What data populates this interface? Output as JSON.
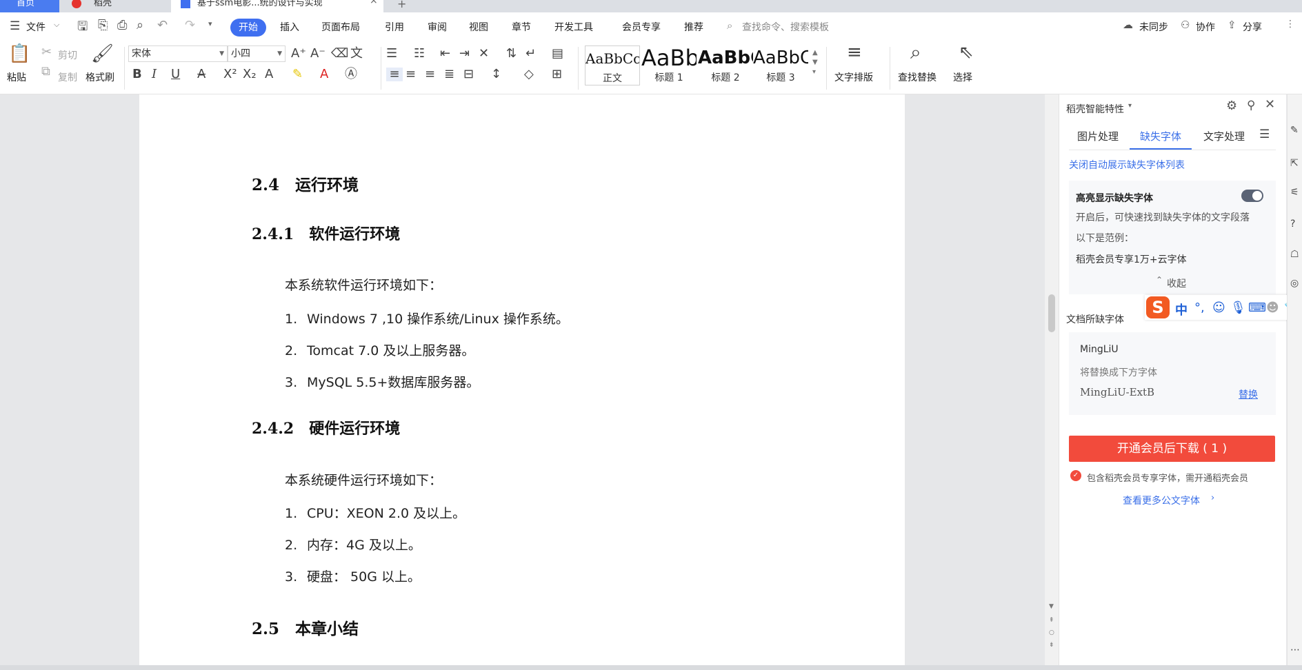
{
  "tabs": {
    "home": "首页",
    "daoke": "稻壳",
    "doc": "基于ssm电影...统的设计与实现"
  },
  "menu": {
    "file": "文件",
    "items": [
      "开始",
      "插入",
      "页面布局",
      "引用",
      "审阅",
      "视图",
      "章节",
      "开发工具",
      "会员专享",
      "推荐"
    ],
    "search_placeholder": "查找命令、搜索模板",
    "unsynced": "未同步",
    "collab": "协作",
    "share": "分享"
  },
  "ribbon": {
    "paste": "粘贴",
    "cut": "剪切",
    "copy": "复制",
    "format_painter": "格式刷",
    "font_name": "宋体",
    "font_size": "小四",
    "styles": [
      {
        "sample": "AaBbCcDd",
        "name": "正文"
      },
      {
        "sample": "AaBb",
        "name": "标题 1"
      },
      {
        "sample": "AaBbC",
        "name": "标题 2"
      },
      {
        "sample": "AaBbC",
        "name": "标题 3"
      }
    ],
    "text_layout": "文字排版",
    "find_replace": "查找替换",
    "select": "选择"
  },
  "document": {
    "h_2_4": "2.4　运行环境",
    "h_2_4_1": "2.4.1　软件运行环境",
    "p_software": "本系统软件运行环境如下：",
    "software_list": [
      {
        "num": "1.",
        "text": "Windows 7 ,10 操作系统/Linux 操作系统。"
      },
      {
        "num": "2.",
        "text": "Tomcat 7.0 及以上服务器。"
      },
      {
        "num": "3.",
        "text": "MySQL 5.5+数据库服务器。"
      }
    ],
    "h_2_4_2": "2.4.2　硬件运行环境",
    "p_hardware": "本系统硬件运行环境如下：",
    "hardware_list": [
      {
        "num": "1.",
        "text": "CPU：XEON 2.0 及以上。"
      },
      {
        "num": "2.",
        "text": "内存：4G 及以上。"
      },
      {
        "num": "3.",
        "text": "硬盘：  50G 以上。"
      }
    ],
    "h_2_5": "2.5　本章小结"
  },
  "panel": {
    "title": "稻壳智能特性",
    "tabs": [
      "图片处理",
      "缺失字体",
      "文字处理"
    ],
    "close_auto_link": "关闭自动展示缺失字体列表",
    "highlight_title": "高亮显示缺失字体",
    "highlight_desc": "开启后，可快速找到缺失字体的文字段落",
    "example_label": "以下是范例：",
    "example_text": "稻壳会员专享1万+云字体",
    "collapse": "收起",
    "missing_title": "文档所缺字体",
    "missing_font": "MingLiU",
    "replace_desc": "将替换成下方字体",
    "replace_font": "MingLiU-ExtB",
    "replace_link": "替换",
    "download_btn": "开通会员后下载 ( 1 )",
    "notice": "包含稻壳会员专享字体，需开通稻壳会员",
    "more_link": "查看更多公文字体"
  },
  "ime": {
    "lang": "中"
  },
  "colors": {
    "accent": "#3f6ff0",
    "download": "#f24b3c"
  }
}
